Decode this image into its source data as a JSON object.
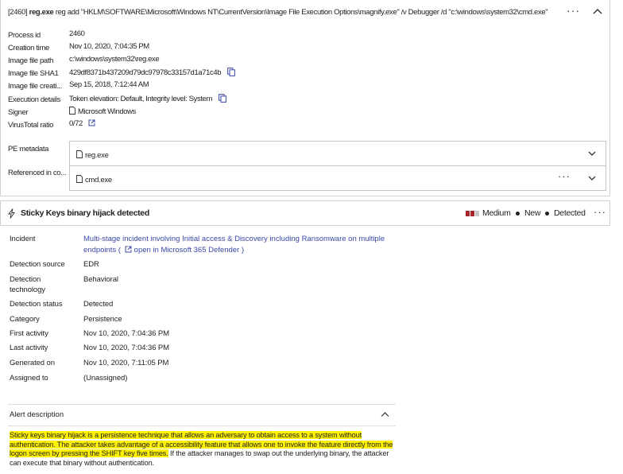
{
  "process": {
    "header_prefix": "[2460]",
    "header_exe": "reg.exe",
    "header_rest": "reg add \"HKLM\\SOFTWARE\\Microsoft\\Windows NT\\CurrentVersion\\Image File Execution Options\\magnify.exe\" /v Debugger /d \"c:\\windows\\system32\\cmd.exe\"",
    "more_label": "···",
    "fields": [
      {
        "label": "Process id",
        "value": "2460"
      },
      {
        "label": "Creation time",
        "value": "Nov 10, 2020, 7:04:35 PM"
      },
      {
        "label": "Image file path",
        "value": "c:\\windows\\system32\\reg.exe"
      },
      {
        "label": "Image file SHA1",
        "value": "429df8371b437209d79dc97978c33157d1a71c4b"
      },
      {
        "label": "Image file creati...",
        "value": "Sep 15, 2018, 7:12:44 AM"
      },
      {
        "label": "Execution details",
        "value": "Token elevation: Default, Integrity level: System"
      },
      {
        "label": "Signer",
        "value": "Microsoft Windows"
      },
      {
        "label": "VirusTotal ratio",
        "value": "0/72"
      }
    ],
    "pe_metadata_label": "PE metadata",
    "pe_metadata_value": "reg.exe",
    "referenced_label": "Referenced in co...",
    "referenced_value": "cmd.exe"
  },
  "alert": {
    "title": "Sticky Keys binary hijack detected",
    "severity": "Medium",
    "status": "New",
    "state": "Detected",
    "more_label": "···",
    "severity_colors": [
      "#a4262c",
      "#a4262c",
      "#c8c6c4"
    ]
  },
  "details": {
    "incident_label": "Incident",
    "incident_value": "Multi-stage incident involving Initial access & Discovery including Ransomware on multiple endpoints (",
    "incident_link": "open in Microsoft 365 Defender",
    "incident_close": ")",
    "rows": [
      {
        "label": "Detection source",
        "value": "EDR"
      },
      {
        "label": "Detection technology",
        "value": "Behavioral"
      },
      {
        "label": "Detection status",
        "value": "Detected"
      },
      {
        "label": "Category",
        "value": "Persistence"
      },
      {
        "label": "First activity",
        "value": "Nov 10, 2020, 7:04:36 PM"
      },
      {
        "label": "Last activity",
        "value": "Nov 10, 2020, 7:04:36 PM"
      },
      {
        "label": "Generated on",
        "value": "Nov 10, 2020, 7:11:05 PM"
      },
      {
        "label": "Assigned to",
        "value": "(Unassigned)"
      }
    ]
  },
  "description": {
    "title": "Alert description",
    "highlighted": "Sticky keys binary hijack is a persistence technique that allows an adversary to obtain access to a system without authentication. The attacker takes advantage of a accessibility feature that allows one to invoke the feature directly from the logon screen by pressing the SHIFT key five times.",
    "rest": " If the attacker manages to swap out the underlying binary, the attacker can execute that binary without authentication."
  }
}
